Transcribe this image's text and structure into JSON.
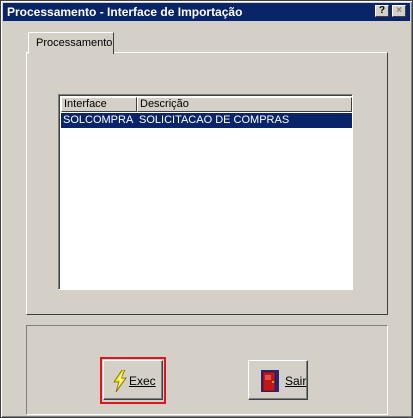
{
  "window": {
    "title": "Processamento - Interface de Importação"
  },
  "titlebar_buttons": {
    "help": "?",
    "close": "×"
  },
  "tabs": [
    {
      "label": "Processamento"
    }
  ],
  "list": {
    "columns": [
      "Interface",
      "Descrição"
    ],
    "rows": [
      {
        "interface": "SOLCOMPRA",
        "descricao": "SOLICITACAO DE COMPRAS",
        "selected": true
      }
    ]
  },
  "buttons": {
    "exec": {
      "label": "Exec",
      "icon": "lightning-icon"
    },
    "sair": {
      "label": "Sair",
      "icon": "door-exit-icon"
    }
  },
  "colors": {
    "titlebar": "#0a246a",
    "selection": "#0a246a",
    "highlight_border": "#e0141e"
  }
}
